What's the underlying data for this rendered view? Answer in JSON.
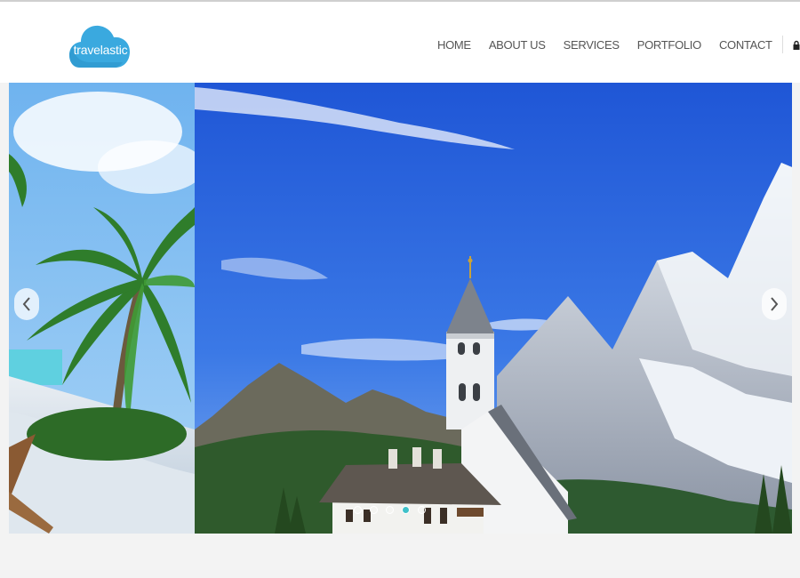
{
  "brand": {
    "name": "travelastic",
    "cloud_color": "#3aa9df"
  },
  "nav": {
    "items": [
      {
        "label": "HOME"
      },
      {
        "label": "ABOUT US"
      },
      {
        "label": "SERVICES"
      },
      {
        "label": "PORTFOLIO"
      },
      {
        "label": "CONTACT"
      }
    ],
    "lock_icon": "lock-icon"
  },
  "slider": {
    "slide_count": 5,
    "active_index": 3,
    "prev_icon": "chevron-left-icon",
    "next_icon": "chevron-right-icon",
    "accent": "#3fc1c9"
  }
}
